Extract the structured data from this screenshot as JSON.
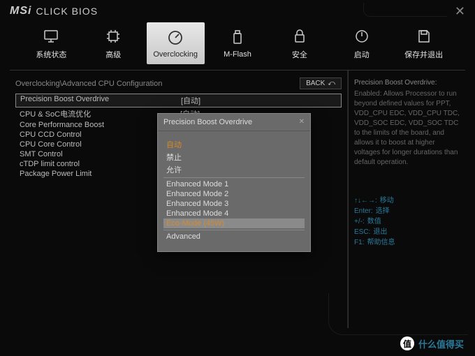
{
  "brand": {
    "msi": "MSi",
    "product": "CLICK BIOS"
  },
  "nav": {
    "items": [
      {
        "label": "系统状态"
      },
      {
        "label": "高级"
      },
      {
        "label": "Overclocking"
      },
      {
        "label": "M-Flash"
      },
      {
        "label": "安全"
      },
      {
        "label": "启动"
      },
      {
        "label": "保存并退出"
      }
    ]
  },
  "breadcrumb": "Overclocking\\Advanced CPU Configuration",
  "back_label": "BACK",
  "settings": [
    {
      "label": "Precision Boost Overdrive",
      "value": "[自动]"
    },
    {
      "label": "CPU & SoC电流优化",
      "value": "[自动]"
    },
    {
      "label": "Core Performance Boost",
      "value": ""
    },
    {
      "label": "CPU CCD Control",
      "value": ""
    },
    {
      "label": "CPU Core Control",
      "value": ""
    },
    {
      "label": "SMT Control",
      "value": ""
    },
    {
      "label": "cTDP limit control",
      "value": ""
    },
    {
      "label": "Package Power Limit",
      "value": ""
    }
  ],
  "help": {
    "title": "Precision Boost Overdrive:",
    "text": "Enabled: Allows Processor to run beyond defined values for PPT, VDD_CPU EDC, VDD_CPU TDC, VDD_SOC EDC, VDD_SOC TDC to the limits of the board, and allows it to boost at higher voltages for longer durations than default operation."
  },
  "keys": [
    {
      "k": "↑↓←→:",
      "v": "移动"
    },
    {
      "k": "Enter:",
      "v": "选择"
    },
    {
      "k": "+/-:",
      "v": "数值"
    },
    {
      "k": "ESC:",
      "v": "退出"
    },
    {
      "k": "F1:",
      "v": "帮助信息"
    }
  ],
  "modal": {
    "title": "Precision Boost Overdrive",
    "options_top": [
      "自动",
      "禁止",
      "允许"
    ],
    "options_mid": [
      "Enhanced Mode 1",
      "Enhanced Mode 2",
      "Enhanced Mode 3",
      "Enhanced Mode 4"
    ],
    "highlight": "Eco-Mode (45W)",
    "options_bottom": [
      "Advanced"
    ]
  },
  "watermark": "什么值得买"
}
